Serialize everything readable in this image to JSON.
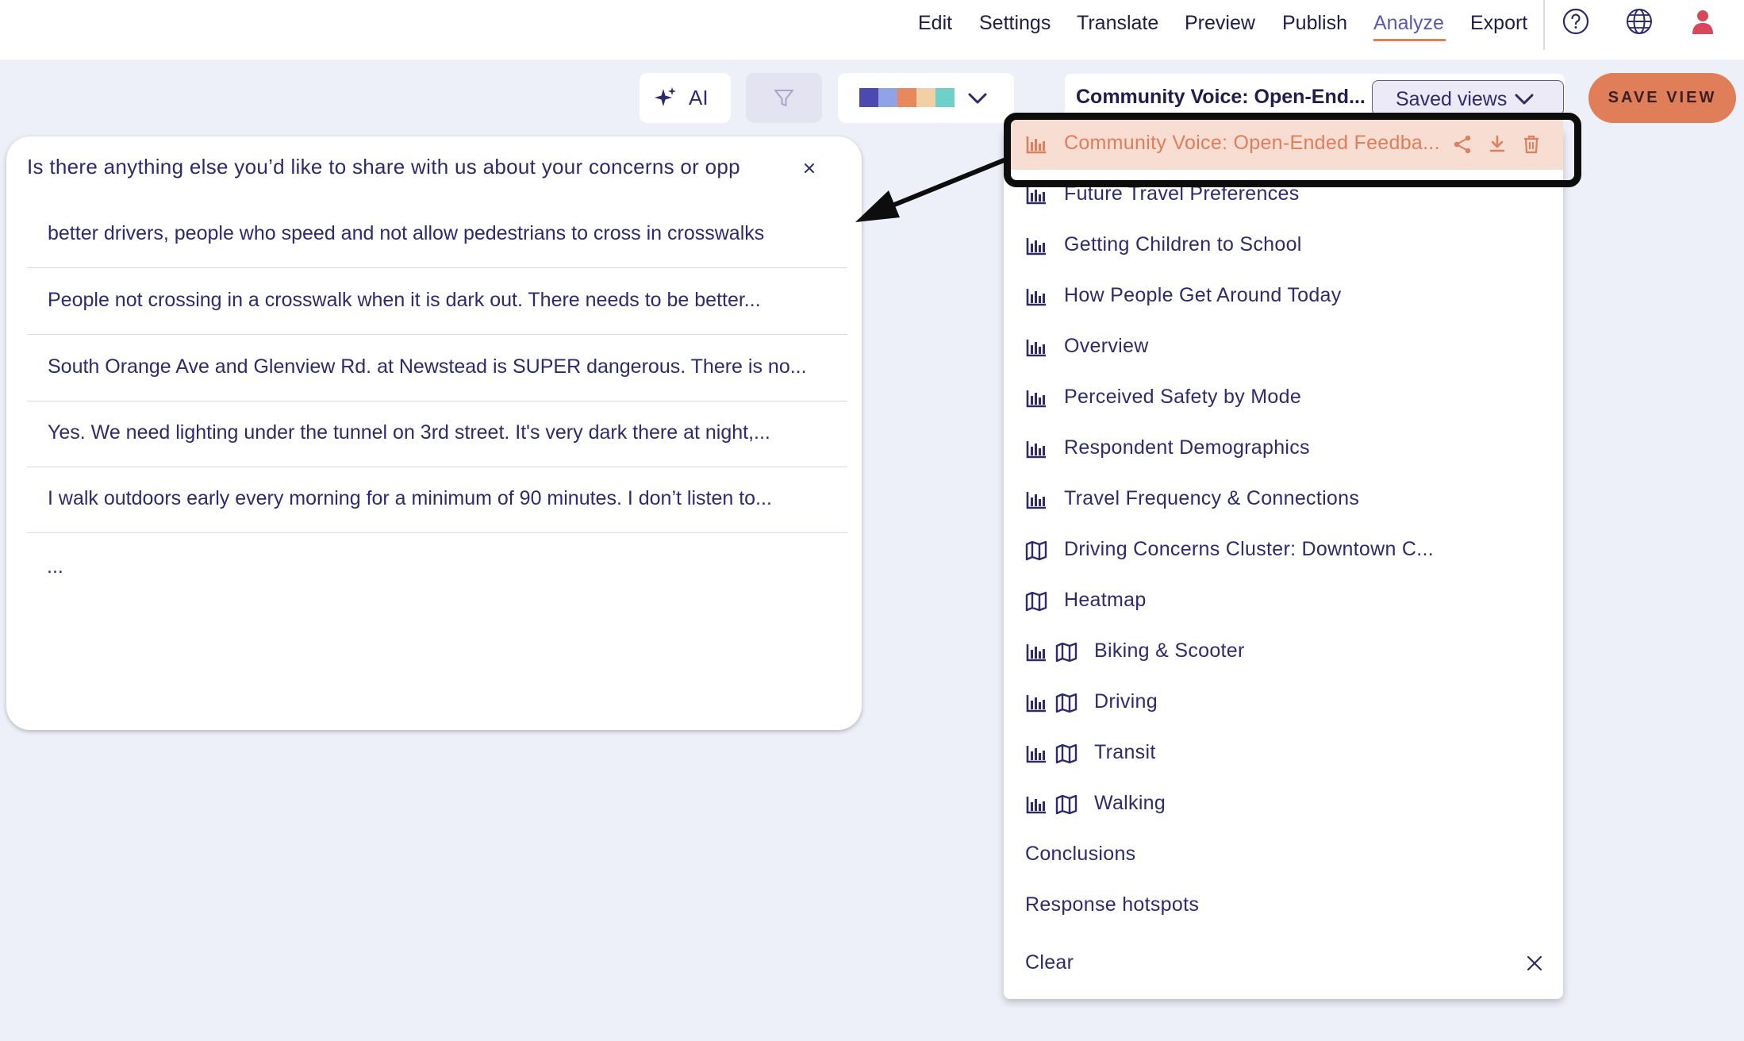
{
  "nav": {
    "links": [
      "Edit",
      "Settings",
      "Translate",
      "Preview",
      "Publish",
      "Analyze",
      "Export"
    ],
    "active": "Analyze",
    "icons": [
      "help-icon",
      "globe-icon",
      "user-icon"
    ]
  },
  "toolbar": {
    "ai_label": "AI",
    "palette_colors": [
      "#4c4ab0",
      "#8ea4e6",
      "#e7895c",
      "#f3d0a4",
      "#6fcfc9"
    ],
    "view_title": "Community Voice: Open-End...",
    "saved_views_label": "Saved views",
    "save_view_label": "SAVE VIEW"
  },
  "card": {
    "title": "Is there anything else you’d like to share with us about your concerns or opp",
    "responses": [
      "better drivers, people who speed and not allow pedestrians to cross in crosswalks",
      "People not crossing in a crosswalk when it is dark out. There needs to be better...",
      "South Orange Ave and Glenview Rd. at Newstead is SUPER dangerous. There is no...",
      "Yes. We need lighting under the tunnel on 3rd street. It's very dark there at night,...",
      "I walk outdoors early every morning for a minimum of 90 minutes. I don’t listen to..."
    ],
    "more": "..."
  },
  "saved_views": {
    "items": [
      {
        "label": "Community Voice: Open-Ended Feedba...",
        "icons": [
          "chart"
        ],
        "selected": true
      },
      {
        "label": "Future Travel Preferences",
        "icons": [
          "chart"
        ]
      },
      {
        "label": "Getting Children to School",
        "icons": [
          "chart"
        ]
      },
      {
        "label": "How People Get Around Today",
        "icons": [
          "chart"
        ]
      },
      {
        "label": "Overview",
        "icons": [
          "chart"
        ]
      },
      {
        "label": "Perceived Safety by Mode",
        "icons": [
          "chart"
        ]
      },
      {
        "label": "Respondent Demographics",
        "icons": [
          "chart"
        ]
      },
      {
        "label": "Travel Frequency & Connections",
        "icons": [
          "chart"
        ]
      },
      {
        "label": "Driving Concerns Cluster: Downtown C...",
        "icons": [
          "map"
        ]
      },
      {
        "label": "Heatmap",
        "icons": [
          "map"
        ]
      },
      {
        "label": "Biking & Scooter",
        "icons": [
          "chart",
          "map"
        ]
      },
      {
        "label": "Driving",
        "icons": [
          "chart",
          "map"
        ]
      },
      {
        "label": "Transit",
        "icons": [
          "chart",
          "map"
        ]
      },
      {
        "label": "Walking",
        "icons": [
          "chart",
          "map"
        ]
      },
      {
        "label": "Conclusions",
        "icons": []
      },
      {
        "label": "Response hotspots",
        "icons": []
      }
    ],
    "clear_label": "Clear"
  }
}
